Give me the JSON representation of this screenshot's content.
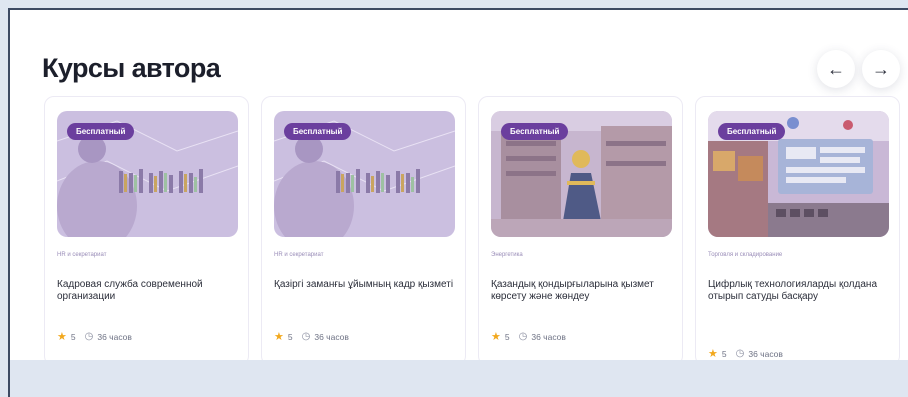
{
  "section_title": "Курсы автора",
  "nav": {
    "prev_icon": "←",
    "next_icon": "→"
  },
  "courses": [
    {
      "badge": "Бесплатный",
      "category": "HR и секретариат",
      "title": "Кадровая служба современной организации",
      "rating": "5",
      "duration": "36 часов"
    },
    {
      "badge": "Бесплатный",
      "category": "HR и секретариат",
      "title": "Қазіргі заманғы ұйымның кадр қызметі",
      "rating": "5",
      "duration": "36 часов"
    },
    {
      "badge": "Бесплатный",
      "category": "Энергетика",
      "title": "Қазандық қондырғыларына қызмет көрсету және жөндеу",
      "rating": "5",
      "duration": "36 часов"
    },
    {
      "badge": "Бесплатный",
      "category": "Торговля и складирование",
      "title": "Цифрлық технологияларды қолдана отырып сатуды басқару",
      "rating": "5",
      "duration": "36 часов"
    }
  ]
}
